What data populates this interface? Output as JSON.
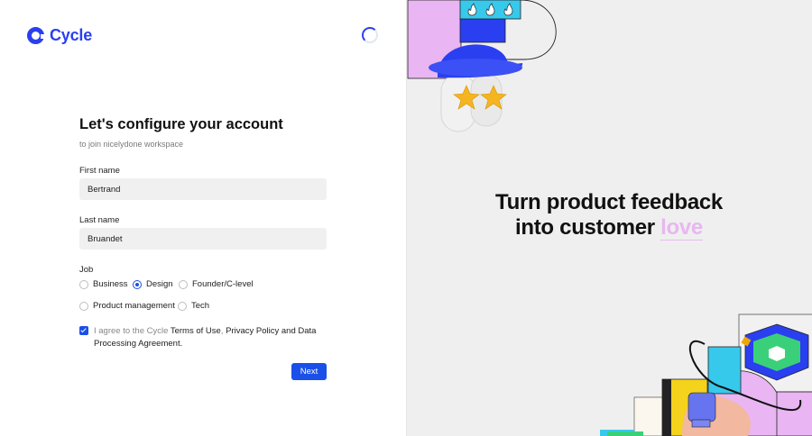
{
  "brand": {
    "name": "Cycle",
    "color": "#2a3ff0"
  },
  "form": {
    "title": "Let's configure your account",
    "subtitle": "to join nicelydone workspace",
    "first_name": {
      "label": "First name",
      "value": "Bertrand"
    },
    "last_name": {
      "label": "Last name",
      "value": "Bruandet"
    },
    "job": {
      "label": "Job",
      "options": [
        "Business",
        "Design",
        "Founder/C-level",
        "Product management",
        "Tech"
      ],
      "selected": "Design"
    },
    "agreement": {
      "checked": true,
      "prefix": "I agree to the Cycle ",
      "terms": "Terms of Use",
      "sep1": ", ",
      "privacy": "Privacy Policy",
      "sep2": " and ",
      "dpa": "Data Processing Agreement",
      "suffix": "."
    },
    "next_label": "Next"
  },
  "hero": {
    "line1": "Turn product feedback",
    "line2_prefix": "into customer ",
    "line2_accent": "love",
    "accent_color": "#e8b7f0"
  },
  "icons": [
    "cycle-logo-icon",
    "loading-spinner-icon",
    "check-icon",
    "flame-icon",
    "star-icon",
    "hexagon-icon",
    "plug-icon"
  ]
}
